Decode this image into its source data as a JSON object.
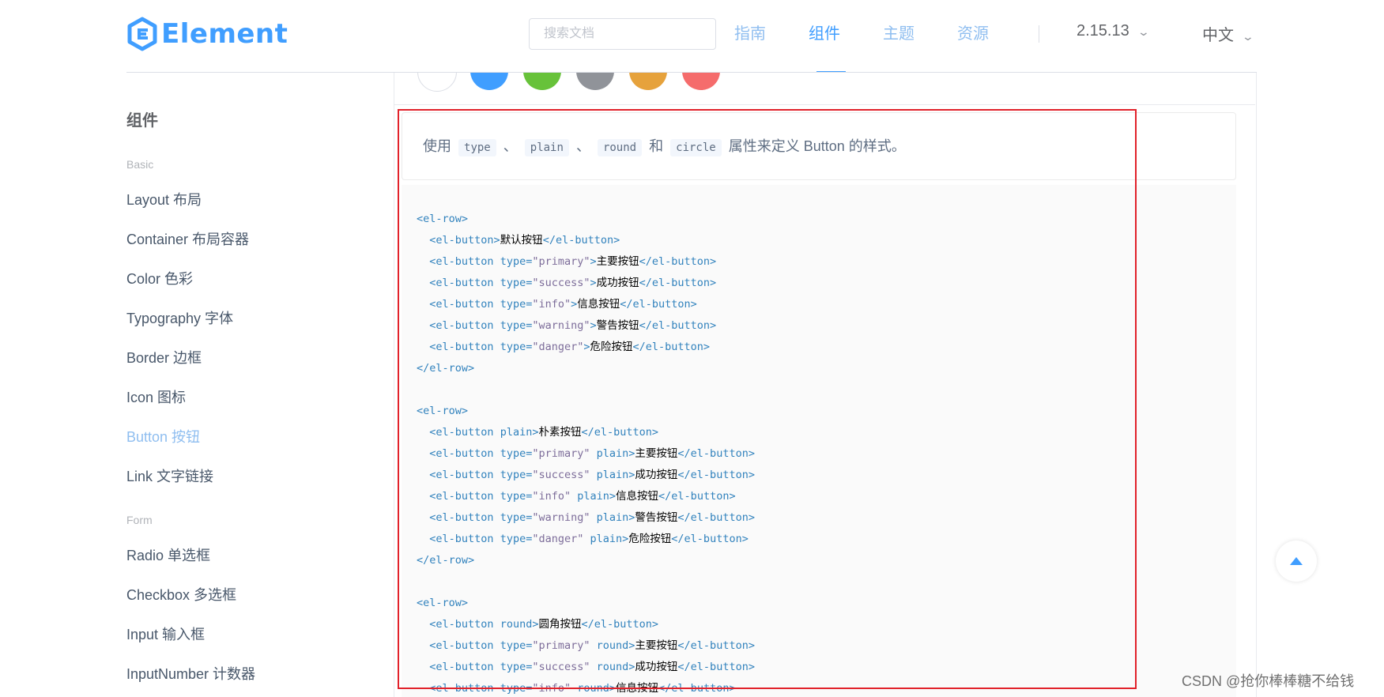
{
  "header": {
    "logo_text": "Element",
    "search_placeholder": "搜索文档",
    "nav": [
      {
        "label": "指南",
        "active": false
      },
      {
        "label": "组件",
        "active": true
      },
      {
        "label": "主题",
        "active": false
      },
      {
        "label": "资源",
        "active": false
      }
    ],
    "version": "2.15.13",
    "language": "中文"
  },
  "sidebar": {
    "title": "组件",
    "groups": [
      {
        "label": "Basic",
        "items": [
          {
            "label": "Layout 布局",
            "active": false
          },
          {
            "label": "Container 布局容器",
            "active": false
          },
          {
            "label": "Color 色彩",
            "active": false
          },
          {
            "label": "Typography 字体",
            "active": false
          },
          {
            "label": "Border 边框",
            "active": false
          },
          {
            "label": "Icon 图标",
            "active": false
          },
          {
            "label": "Button 按钮",
            "active": true
          },
          {
            "label": "Link 文字链接",
            "active": false
          }
        ]
      },
      {
        "label": "Form",
        "items": [
          {
            "label": "Radio 单选框",
            "active": false
          },
          {
            "label": "Checkbox 多选框",
            "active": false
          },
          {
            "label": "Input 输入框",
            "active": false
          },
          {
            "label": "InputNumber 计数器",
            "active": false
          }
        ]
      }
    ]
  },
  "demo": {
    "circle_colors": [
      "#ffffff",
      "#409eff",
      "#67c23a",
      "#909399",
      "#e6a23c",
      "#f56c6c"
    ],
    "description": {
      "prefix": "使用",
      "codes": [
        "type",
        "plain",
        "round",
        "circle"
      ],
      "sep1": "、",
      "sep2": "、",
      "and": "和",
      "suffix": "属性来定义 Button 的样式。"
    },
    "code_lines": [
      "<el-row>",
      "  <el-button>默认按钮</el-button>",
      "  <el-button type=\"primary\">主要按钮</el-button>",
      "  <el-button type=\"success\">成功按钮</el-button>",
      "  <el-button type=\"info\">信息按钮</el-button>",
      "  <el-button type=\"warning\">警告按钮</el-button>",
      "  <el-button type=\"danger\">危险按钮</el-button>",
      "</el-row>",
      "",
      "<el-row>",
      "  <el-button plain>朴素按钮</el-button>",
      "  <el-button type=\"primary\" plain>主要按钮</el-button>",
      "  <el-button type=\"success\" plain>成功按钮</el-button>",
      "  <el-button type=\"info\" plain>信息按钮</el-button>",
      "  <el-button type=\"warning\" plain>警告按钮</el-button>",
      "  <el-button type=\"danger\" plain>危险按钮</el-button>",
      "</el-row>",
      "",
      "<el-row>",
      "  <el-button round>圆角按钮</el-button>",
      "  <el-button type=\"primary\" round>主要按钮</el-button>",
      "  <el-button type=\"success\" round>成功按钮</el-button>",
      "  <el-button type=\"info\" round>信息按钮</el-button>"
    ]
  },
  "colors": {
    "accent": "#409eff",
    "highlight_box": "#e1212a"
  },
  "icons": {
    "back_to_top": "caret-up-icon",
    "dropdown": "chevron-down-icon",
    "logo": "hexagon-logo-icon"
  },
  "watermark": "CSDN @抢你棒棒糖不给钱"
}
